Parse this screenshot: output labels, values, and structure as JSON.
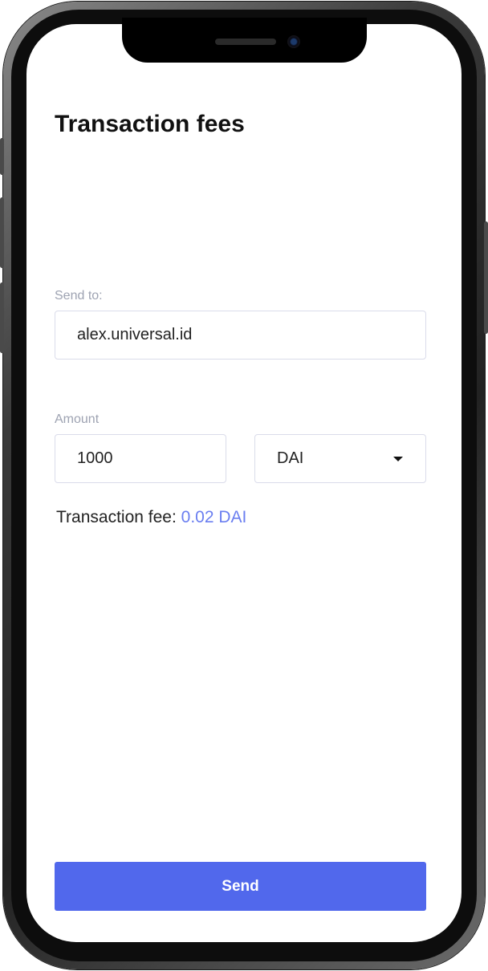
{
  "screen": {
    "title": "Transaction fees"
  },
  "send_to": {
    "label": "Send to:",
    "value": "alex.universal.id"
  },
  "amount": {
    "label": "Amount",
    "value": "1000",
    "currency": "DAI",
    "currency_icon": "chevron-down-icon"
  },
  "fee": {
    "label": "Transaction fee: ",
    "value": "0.02 DAI"
  },
  "actions": {
    "send_label": "Send"
  },
  "colors": {
    "accent": "#5168ec",
    "fee_value": "#6a7ef0",
    "label_gray": "#9ea3b2"
  }
}
